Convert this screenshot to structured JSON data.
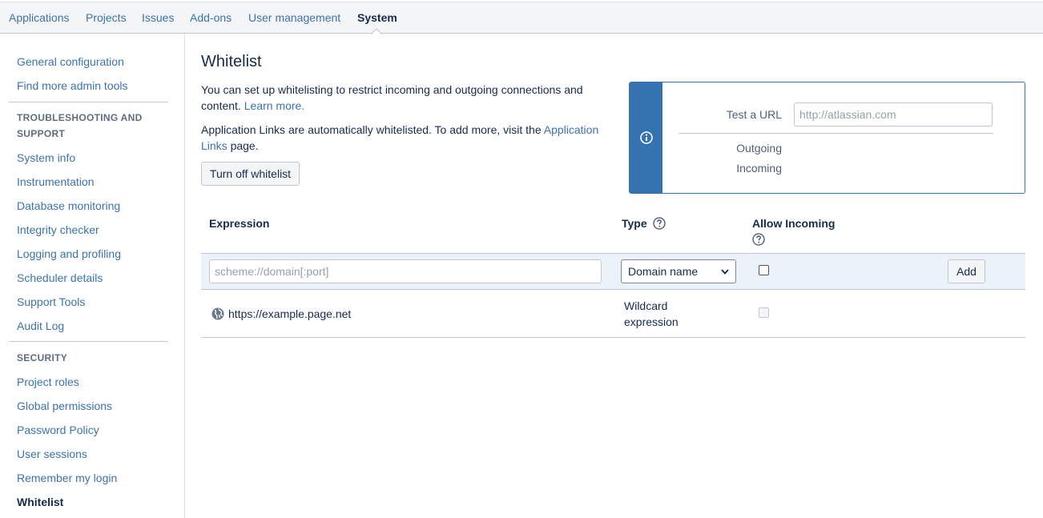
{
  "topnav": {
    "tabs": [
      {
        "label": "Applications"
      },
      {
        "label": "Projects"
      },
      {
        "label": "Issues"
      },
      {
        "label": "Add-ons"
      },
      {
        "label": "User management"
      },
      {
        "label": "System"
      }
    ],
    "active_tab": "System"
  },
  "sidebar": {
    "items": [
      {
        "label": "General configuration"
      },
      {
        "label": "Find more admin tools"
      }
    ],
    "troubleshooting": {
      "heading": "TROUBLESHOOTING AND SUPPORT",
      "items": [
        {
          "label": "System info"
        },
        {
          "label": "Instrumentation"
        },
        {
          "label": "Database monitoring"
        },
        {
          "label": "Integrity checker"
        },
        {
          "label": "Logging and profiling"
        },
        {
          "label": "Scheduler details"
        },
        {
          "label": "Support Tools"
        },
        {
          "label": "Audit Log"
        }
      ]
    },
    "security": {
      "heading": "SECURITY",
      "items": [
        {
          "label": "Project roles"
        },
        {
          "label": "Global permissions"
        },
        {
          "label": "Password Policy"
        },
        {
          "label": "User sessions"
        },
        {
          "label": "Remember my login"
        },
        {
          "label": "Whitelist"
        }
      ]
    },
    "active_item": "Whitelist"
  },
  "main": {
    "title": "Whitelist",
    "intro_text": "You can set up whitelisting to restrict incoming and outgoing connections and content.",
    "learn_more_link": "Learn more.",
    "applinks_text": "Application Links are automatically whitelisted. To add more, visit the",
    "applinks_link": "Application Links",
    "applinks_suffix": "page.",
    "turn_off_button": "Turn off whitelist"
  },
  "test_panel": {
    "test_url_label": "Test a URL",
    "test_url_placeholder": "http://atlassian.com",
    "outgoing_label": "Outgoing",
    "incoming_label": "Incoming",
    "info_icon": "info-icon"
  },
  "table": {
    "headers": {
      "expression": "Expression",
      "type": "Type",
      "allow_incoming": "Allow Incoming"
    },
    "add_row": {
      "expression_placeholder": "scheme://domain[:port]",
      "type_selected": "Domain name",
      "allow_incoming_checked": false,
      "add_button": "Add"
    },
    "rows": [
      {
        "expression": "https://example.page.net",
        "type": "Wildcard expression",
        "allow_incoming_checked": false,
        "allow_incoming_disabled": true,
        "icon": "globe-icon"
      }
    ]
  },
  "colors": {
    "link": "#3b73af",
    "info_bar": "#3572b0",
    "add_row_bg": "#ebf2f9",
    "nav_bg": "#f4f5f7"
  }
}
